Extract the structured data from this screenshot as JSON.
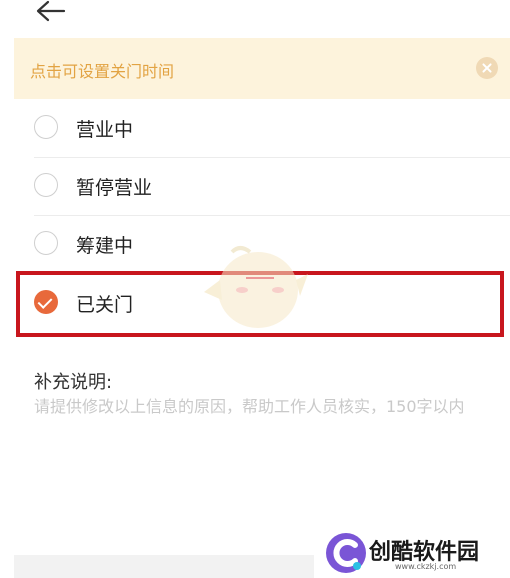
{
  "notice": {
    "text": "点击可设置关门时间"
  },
  "options": [
    {
      "label": "营业中",
      "checked": false
    },
    {
      "label": "暂停营业",
      "checked": false
    },
    {
      "label": "筹建中",
      "checked": false
    },
    {
      "label": "已关门",
      "checked": true
    }
  ],
  "supplement": {
    "title": "补充说明:",
    "placeholder": "请提供修改以上信息的原因，帮助工作人员核实，150字以内"
  },
  "watermark": {
    "name": "创酷软件园",
    "url": "www.ckzkj.com"
  },
  "colors": {
    "accent": "#e8693b",
    "highlight": "#c8161d",
    "notice_bg": "#fdf3dc",
    "notice_text": "#e2a343"
  },
  "icons": {
    "back": "arrow-left-icon",
    "close": "close-circle-icon",
    "check": "check-icon"
  }
}
